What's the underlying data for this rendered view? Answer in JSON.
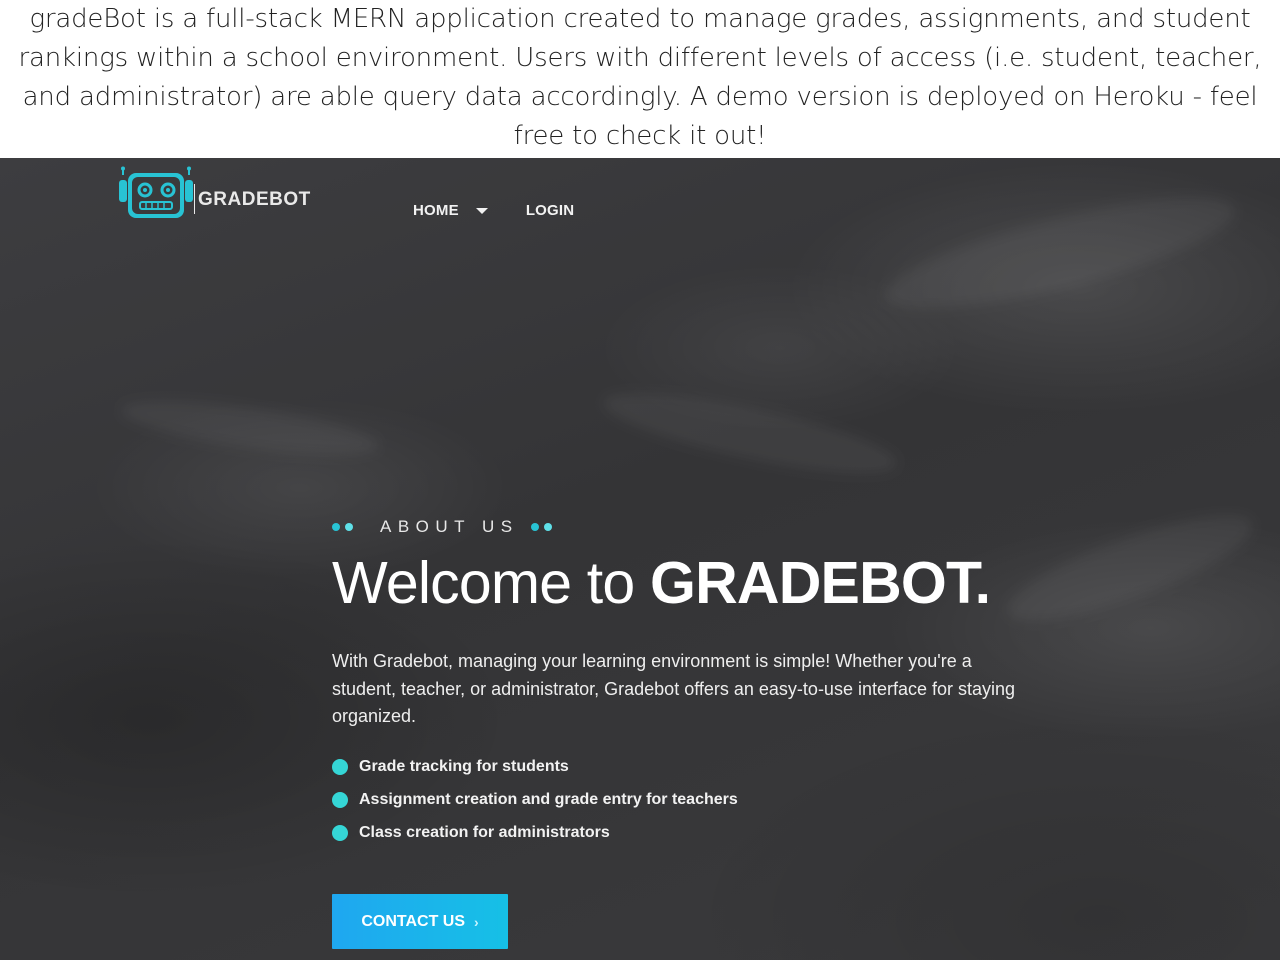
{
  "caption": {
    "text": "gradeBot is a full-stack MERN application created to manage grades, assignments, and student rankings within a school environment.  Users with different levels of access (i.e. student, teacher, and administrator) are able query data accordingly.  A demo version is deployed on Heroku - feel free to check it out!"
  },
  "brand": {
    "name": "GRADEBOT",
    "logo_icon": "robot-icon",
    "accent_color": "#28c3d4"
  },
  "nav": {
    "items": [
      {
        "label": "HOME",
        "has_dropdown": true,
        "dropdown_icon": "caret-down-icon"
      },
      {
        "label": "LOGIN",
        "has_dropdown": false
      }
    ]
  },
  "hero": {
    "eyebrow": "ABOUT US",
    "headline_light": "Welcome to ",
    "headline_bold": "GRADEBOT.",
    "intro": "With Gradebot, managing your learning environment is simple! Whether you're a student, teacher, or administrator, Gradebot offers an easy-to-use interface for staying organized.",
    "features": [
      "Grade tracking for students",
      "Assignment creation and grade entry for teachers",
      "Class creation for administrators"
    ],
    "bullet_color": "#35d6d6"
  },
  "cta": {
    "label": "CONTACT US",
    "icon": "chevron-right-icon",
    "gradient": [
      "#1fa7f0",
      "#16c0e6"
    ]
  }
}
